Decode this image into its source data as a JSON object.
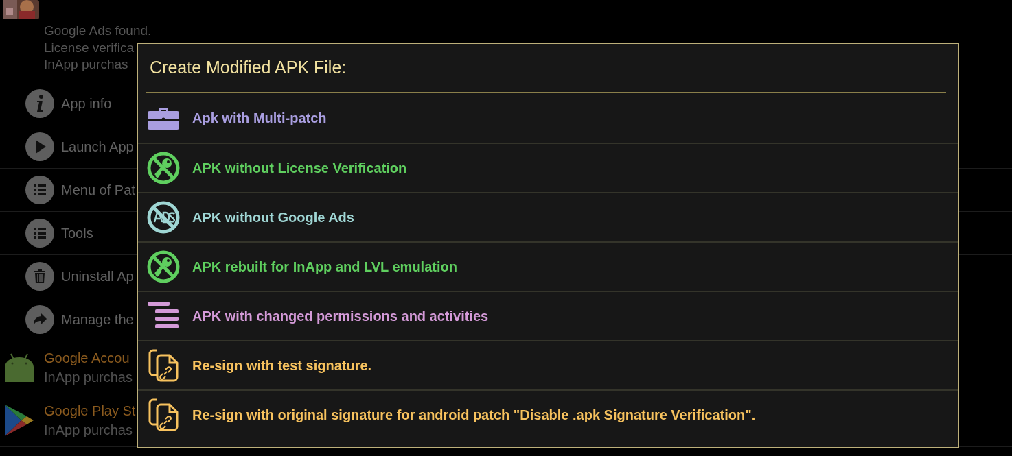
{
  "background_list": {
    "top_app": {
      "lines": [
        "Google Ads found.",
        "License verifica",
        "InApp purchas"
      ]
    },
    "menu_items": [
      {
        "kind": "info",
        "label": "App info"
      },
      {
        "kind": "launch",
        "label": "Launch App"
      },
      {
        "kind": "list",
        "label": "Menu of Pat"
      },
      {
        "kind": "list",
        "label": "Tools"
      },
      {
        "kind": "trash",
        "label": "Uninstall Ap"
      },
      {
        "kind": "share",
        "label": "Manage the"
      }
    ],
    "apps": [
      {
        "kind": "android",
        "title": "Google Accou",
        "subtitle": "InApp purchas"
      },
      {
        "kind": "play",
        "title": "Google Play St",
        "subtitle": "InApp purchas"
      }
    ]
  },
  "dialog": {
    "title": "Create Modified APK File:",
    "items": [
      {
        "kind": "briefcase",
        "label": "Apk with Multi-patch",
        "color": "#a99ee0"
      },
      {
        "kind": "no-key",
        "label": "APK without License Verification",
        "color": "#5fcf5f"
      },
      {
        "kind": "no-ads",
        "label": "APK without Google Ads",
        "color": "#9fd6d4"
      },
      {
        "kind": "no-key",
        "label": "APK rebuilt for InApp and LVL emulation",
        "color": "#5fcf5f"
      },
      {
        "kind": "permissions",
        "label": "APK with changed permissions and activities",
        "color": "#d49ad8"
      },
      {
        "kind": "resign",
        "label": "Re-sign with test signature.",
        "color": "#f7c25e"
      },
      {
        "kind": "resign",
        "label": "Re-sign with original signature for android patch \"Disable .apk Signature Verification\".",
        "color": "#f7c25e"
      }
    ]
  }
}
